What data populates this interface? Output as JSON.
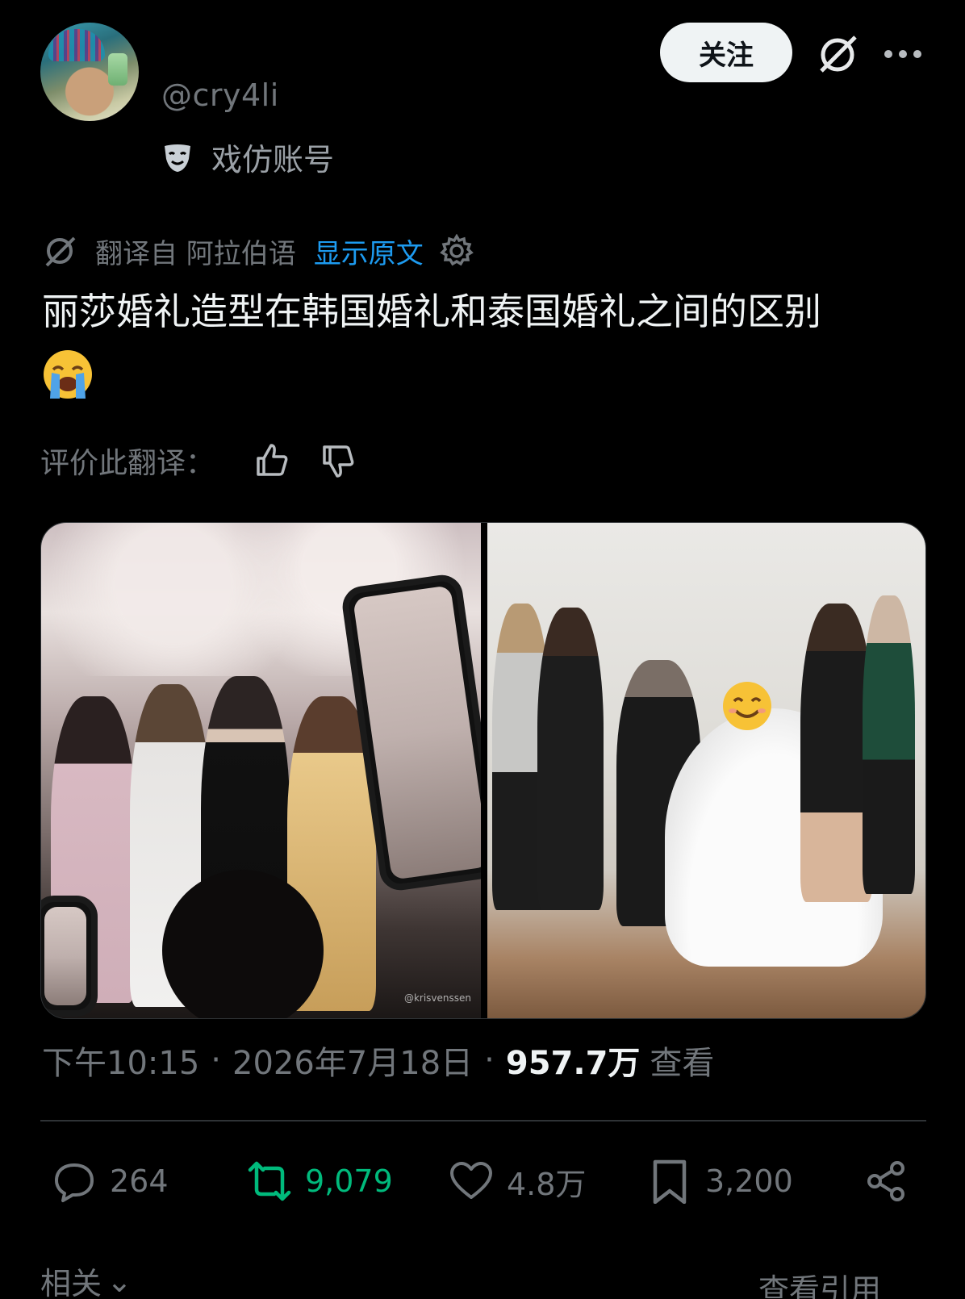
{
  "header": {
    "handle": "@cry4li",
    "parody_label": "戏仿账号",
    "follow_label": "关注",
    "icons": [
      "parody-mask-icon",
      "grok-icon",
      "more-icon"
    ]
  },
  "translation": {
    "label": "翻译自 阿拉伯语",
    "show_original": "显示原文",
    "accent": "#1d9bf0"
  },
  "post": {
    "text": "丽莎婚礼造型在韩国婚礼和泰国婚礼之间的区别",
    "emoji": "loudly-crying-face"
  },
  "rate": {
    "label": "评价此翻译："
  },
  "media": {
    "left_watermark": "@krisvenssen",
    "right_overlay_emoji": "smiling-face"
  },
  "meta": {
    "time": "下午10:15",
    "date": "2026年7月18日",
    "views": "957.7万",
    "views_label": "查看"
  },
  "actions": {
    "replies": "264",
    "reposts": "9,079",
    "likes": "4.8万",
    "bookmarks": "3,200",
    "repost_color": "#00ba7c"
  },
  "footer": {
    "related": "相关",
    "quotes": "查看引用"
  }
}
